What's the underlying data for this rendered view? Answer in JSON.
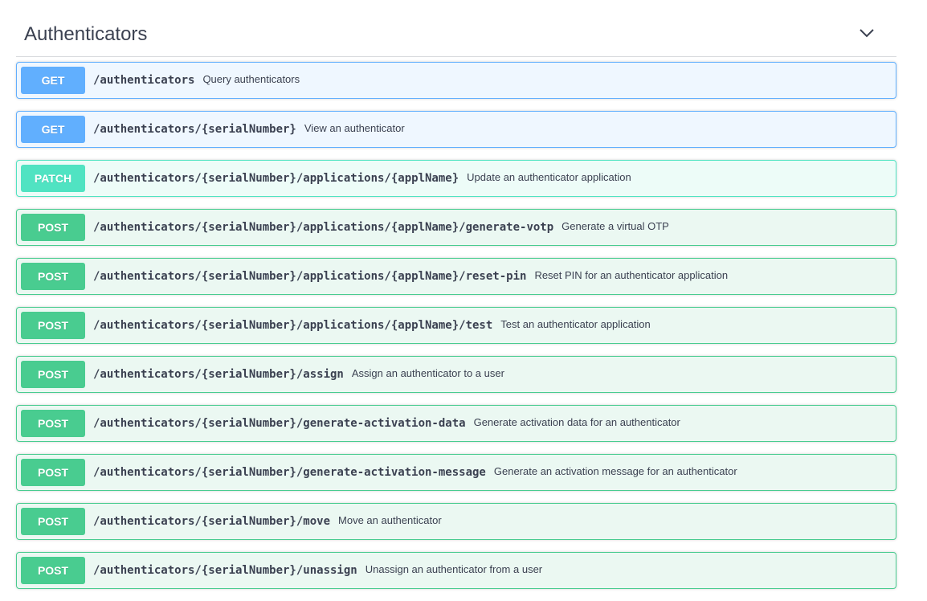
{
  "section": {
    "title": "Authenticators",
    "toggle_icon": "chevron-down-icon"
  },
  "colors": {
    "get": "#61affe",
    "patch": "#50e3c2",
    "post": "#49cc90",
    "text": "#3b4151"
  },
  "operations": [
    {
      "method": "GET",
      "path": "/authenticators",
      "summary": "Query authenticators"
    },
    {
      "method": "GET",
      "path": "/authenticators/{serialNumber}",
      "summary": "View an authenticator"
    },
    {
      "method": "PATCH",
      "path": "/authenticators/{serialNumber}/applications/{applName}",
      "summary": "Update an authenticator application"
    },
    {
      "method": "POST",
      "path": "/authenticators/{serialNumber}/applications/{applName}/generate-votp",
      "summary": "Generate a virtual OTP"
    },
    {
      "method": "POST",
      "path": "/authenticators/{serialNumber}/applications/{applName}/reset-pin",
      "summary": "Reset PIN for an authenticator application"
    },
    {
      "method": "POST",
      "path": "/authenticators/{serialNumber}/applications/{applName}/test",
      "summary": "Test an authenticator application"
    },
    {
      "method": "POST",
      "path": "/authenticators/{serialNumber}/assign",
      "summary": "Assign an authenticator to a user"
    },
    {
      "method": "POST",
      "path": "/authenticators/{serialNumber}/generate-activation-data",
      "summary": "Generate activation data for an authenticator"
    },
    {
      "method": "POST",
      "path": "/authenticators/{serialNumber}/generate-activation-message",
      "summary": "Generate an activation message for an authenticator"
    },
    {
      "method": "POST",
      "path": "/authenticators/{serialNumber}/move",
      "summary": "Move an authenticator"
    },
    {
      "method": "POST",
      "path": "/authenticators/{serialNumber}/unassign",
      "summary": "Unassign an authenticator from a user"
    }
  ]
}
